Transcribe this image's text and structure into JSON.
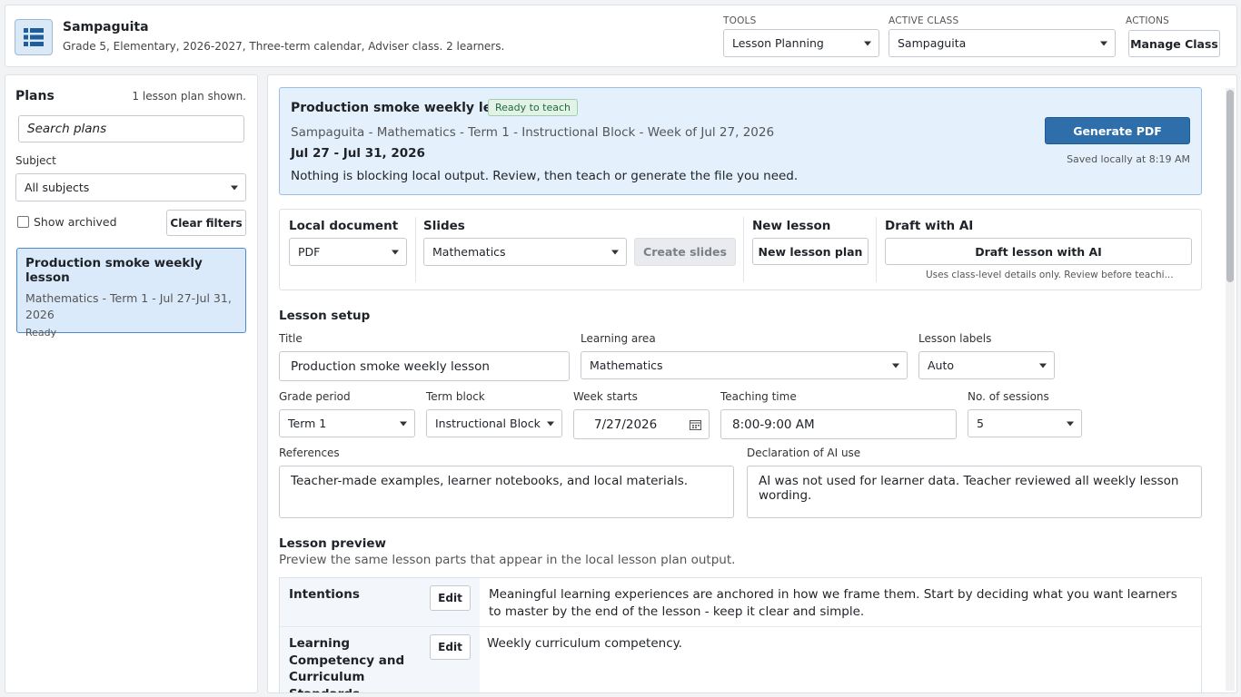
{
  "header": {
    "class_name": "Sampaguita",
    "class_desc": "Grade 5, Elementary, 2026-2027, Three-term calendar, Adviser class. 2 learners.",
    "tools_label": "TOOLS",
    "tools_value": "Lesson Planning",
    "active_class_label": "ACTIVE CLASS",
    "active_class_value": "Sampaguita",
    "actions_label": "ACTIONS",
    "manage_class": "Manage Class"
  },
  "sidebar": {
    "title": "Plans",
    "count": "1 lesson plan shown.",
    "search_placeholder": "Search plans",
    "subject_label": "Subject",
    "subject_value": "All subjects",
    "show_archived": "Show archived",
    "clear_filters": "Clear filters",
    "plans": [
      {
        "title": "Production smoke weekly lesson",
        "subtitle": "Mathematics - Term 1 - Jul 27-Jul 31, 2026",
        "status": "Ready"
      }
    ]
  },
  "status": {
    "title": "Production smoke weekly lesson",
    "badge": "Ready to teach",
    "path": "Sampaguita - Mathematics - Term 1 - Instructional Block - Week of Jul 27, 2026",
    "dates": "Jul 27 - Jul 31, 2026",
    "message": "Nothing is blocking local output. Review, then teach or generate the file you need.",
    "generate": "Generate PDF",
    "saved": "Saved locally at 8:19 AM"
  },
  "tools": {
    "local_doc_label": "Local document",
    "local_doc_value": "PDF",
    "slides_label": "Slides",
    "slides_value": "Mathematics",
    "create_slides": "Create slides",
    "new_lesson_label": "New lesson",
    "new_lesson_button": "New lesson plan",
    "draft_label": "Draft with AI",
    "draft_button": "Draft lesson with AI",
    "draft_note": "Uses class-level details only. Review before teachi..."
  },
  "setup": {
    "section": "Lesson setup",
    "title_label": "Title",
    "title_value": "Production smoke weekly lesson",
    "area_label": "Learning area",
    "area_value": "Mathematics",
    "labels_label": "Lesson labels",
    "labels_value": "Auto",
    "grade_period_label": "Grade period",
    "grade_period_value": "Term 1",
    "term_block_label": "Term block",
    "term_block_value": "Instructional Block",
    "week_label": "Week starts",
    "week_value": "7/27/2026",
    "time_label": "Teaching time",
    "time_value": "8:00-9:00 AM",
    "sessions_label": "No. of sessions",
    "sessions_value": "5",
    "refs_label": "References",
    "refs_value": "Teacher-made examples, learner notebooks, and local materials.",
    "ai_label": "Declaration of AI use",
    "ai_value": "AI was not used for learner data. Teacher reviewed all weekly lesson wording."
  },
  "preview": {
    "section": "Lesson preview",
    "subtitle": "Preview the same lesson parts that appear in the local lesson plan output.",
    "edit": "Edit",
    "rows": [
      {
        "name": "Intentions",
        "content": "Meaningful learning experiences are anchored in how we frame them. Start by deciding what you want learners to master by the end of the lesson - keep it clear and simple."
      },
      {
        "name": "Learning Competency and Curriculum Standards",
        "content": "Weekly curriculum competency."
      }
    ]
  }
}
